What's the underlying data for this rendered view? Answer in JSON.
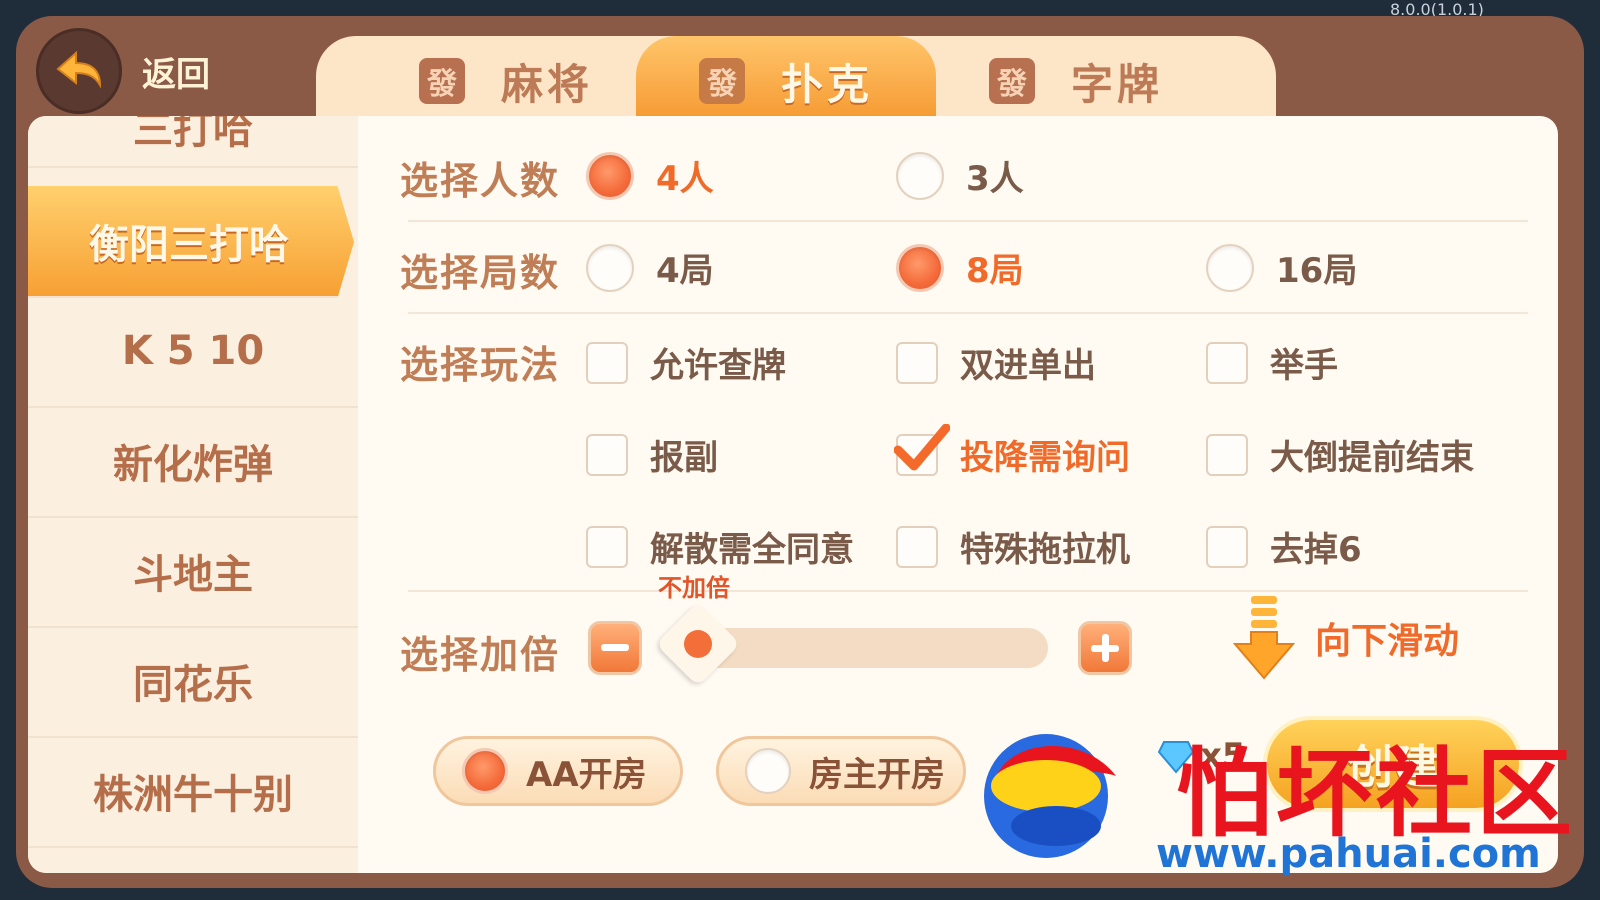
{
  "version": "8.0.0(1.0.1)",
  "back": {
    "label": "返回"
  },
  "tabs": [
    {
      "icon_glyph": "發",
      "label": "麻将",
      "active": false
    },
    {
      "icon_glyph": "發",
      "label": "扑克",
      "active": true
    },
    {
      "icon_glyph": "發",
      "label": "字牌",
      "active": false
    }
  ],
  "sidebar": {
    "items": [
      {
        "label": "三打哈",
        "partial": true
      },
      {
        "label": "衡阳三打哈",
        "active": true
      },
      {
        "label": "K 5 10"
      },
      {
        "label": "新化炸弹"
      },
      {
        "label": "斗地主"
      },
      {
        "label": "同花乐"
      },
      {
        "label": "株洲牛十别"
      }
    ]
  },
  "players": {
    "label": "选择人数",
    "options": [
      {
        "label": "4人",
        "selected": true
      },
      {
        "label": "3人",
        "selected": false
      }
    ]
  },
  "rounds": {
    "label": "选择局数",
    "options": [
      {
        "label": "4局",
        "selected": false
      },
      {
        "label": "8局",
        "selected": true
      },
      {
        "label": "16局",
        "selected": false
      }
    ]
  },
  "rules": {
    "label": "选择玩法",
    "options": [
      {
        "label": "允许查牌",
        "checked": false
      },
      {
        "label": "双进单出",
        "checked": false
      },
      {
        "label": "举手",
        "checked": false
      },
      {
        "label": "报副",
        "checked": false
      },
      {
        "label": "投降需询问",
        "checked": true
      },
      {
        "label": "大倒提前结束",
        "checked": false
      },
      {
        "label": "解散需全同意",
        "checked": false
      },
      {
        "label": "特殊拖拉机",
        "checked": false
      },
      {
        "label": "去掉6",
        "checked": false
      }
    ]
  },
  "multiplier": {
    "label": "选择加倍",
    "value_label": "不加倍",
    "level": 0
  },
  "scroll_hint": "向下滑动",
  "room_pay": {
    "options": [
      {
        "label": "AA开房",
        "selected": true
      },
      {
        "label": "房主开房",
        "selected": false
      }
    ]
  },
  "cost": {
    "value": "x5"
  },
  "create_button": "创建",
  "watermark": {
    "text": "怕坏社区",
    "url": "www.pahuai.com"
  },
  "colors": {
    "accent": "#f46a3a",
    "panel": "#8a5a47",
    "card": "#fffaf2",
    "label": "#c07e57"
  }
}
